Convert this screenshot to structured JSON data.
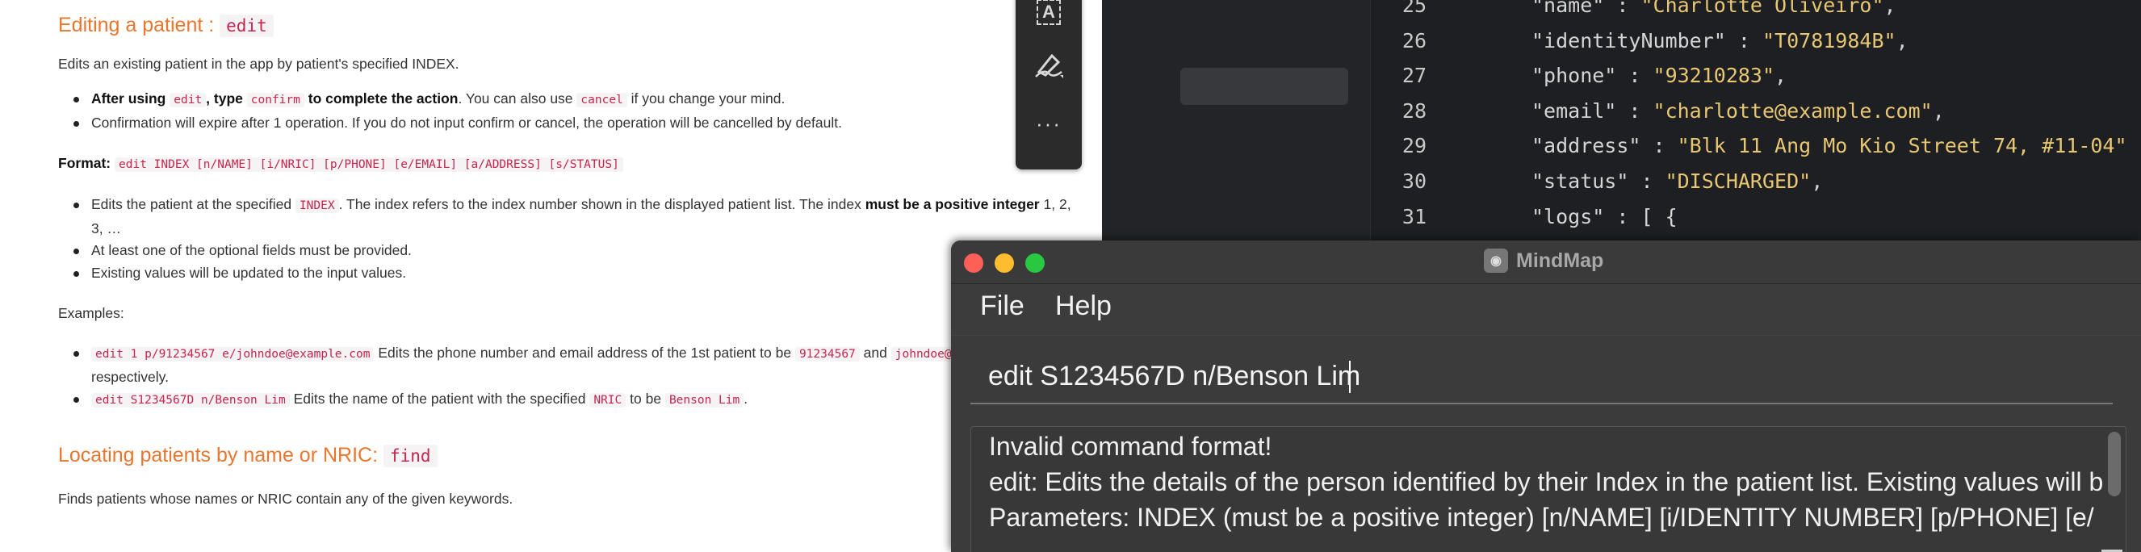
{
  "doc": {
    "editing": {
      "heading": "Editing a patient :",
      "heading_code": "edit",
      "intro": "Edits an existing patient in the app by patient's specified INDEX.",
      "note1_after": "After using",
      "note1_code1": "edit",
      "note1_type": ", type",
      "note1_code2": "confirm",
      "note1_complete": "to complete the action",
      "note1_also": ". You can also use",
      "note1_code3": "cancel",
      "note1_tail": "if you change your mind.",
      "note2": "Confirmation will expire after 1 operation. If you do not input confirm or cancel, the operation will be cancelled by default.",
      "format_label": "Format:",
      "format_code": "edit INDEX [n/NAME] [i/NRIC] [p/PHONE] [e/EMAIL] [a/ADDRESS] [s/STATUS]",
      "b1_pre": "Edits the patient at the specified",
      "b1_code": "INDEX",
      "b1_mid": ". The index refers to the index number shown in the displayed patient list. The index",
      "b1_bold": "must be a positive integer",
      "b1_tail": "1, 2, 3, …",
      "b2": "At least one of the optional fields must be provided.",
      "b3": "Existing values will be updated to the input values.",
      "examples_label": "Examples:",
      "ex1_code": "edit 1 p/91234567 e/johndoe@example.com",
      "ex1_text": "Edits the phone number and email address of the 1st patient to be",
      "ex1_code2": "91234567",
      "ex1_and": "and",
      "ex1_code3": "johndoe@example.com",
      "ex1_tail": "respectively.",
      "ex2_code": "edit S1234567D n/Benson Lim",
      "ex2_text": "Edits the name of the patient with the specified",
      "ex2_code2": "NRIC",
      "ex2_to": "to be",
      "ex2_code3": "Benson Lim",
      "ex2_tail": "."
    },
    "locating": {
      "heading": "Locating patients by name or NRIC:",
      "heading_code": "find",
      "intro": "Finds patients whose names or NRIC contain any of the given keywords."
    }
  },
  "toolbar": {
    "text_tool_glyph": "A",
    "more_glyph": "···"
  },
  "ide": {
    "lines": [
      {
        "num": "25",
        "key": "\"name\"",
        "sep": " : ",
        "val": "\"Charlotte Oliveiro\"",
        "end": ","
      },
      {
        "num": "26",
        "key": "\"identityNumber\"",
        "sep": " : ",
        "val": "\"T0781984B\"",
        "end": ","
      },
      {
        "num": "27",
        "key": "\"phone\"",
        "sep": " : ",
        "val": "\"93210283\"",
        "end": ","
      },
      {
        "num": "28",
        "key": "\"email\"",
        "sep": " : ",
        "val": "\"charlotte@example.com\"",
        "end": ","
      },
      {
        "num": "29",
        "key": "\"address\"",
        "sep": " : ",
        "val": "\"Blk 11 Ang Mo Kio Street 74, #11-04\"",
        "end": ""
      },
      {
        "num": "30",
        "key": "\"status\"",
        "sep": " : ",
        "val": "\"DISCHARGED\"",
        "end": ","
      },
      {
        "num": "31",
        "key": "\"logs\"",
        "sep": " : ",
        "val": "",
        "end": "[ {"
      }
    ]
  },
  "app": {
    "title": "MindMap",
    "menu_file": "File",
    "menu_help": "Help",
    "command_value": "edit S1234567D n/Benson Lim",
    "result_line1": "Invalid command format!",
    "result_line2": "edit: Edits the details of the person identified by their Index in the patient list. Existing values will b",
    "result_line3": "Parameters: INDEX (must be a positive integer) [n/NAME] [i/IDENTITY NUMBER] [p/PHONE] [e/"
  },
  "colors": {
    "heading_orange": "#e8762d",
    "code_pink": "#c7254e",
    "json_string": "#e8c773",
    "close": "#fe5f57",
    "minimize": "#febc2e",
    "zoom": "#28c840"
  }
}
